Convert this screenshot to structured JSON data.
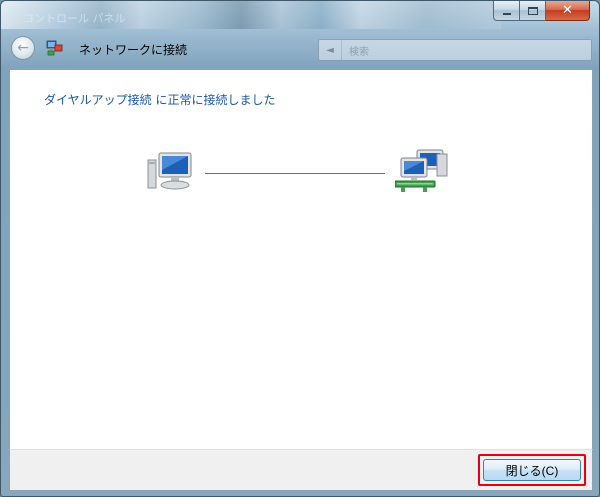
{
  "window": {
    "faint_title": "コントロール パネル",
    "controls": {
      "minimize_icon": "minimize-icon",
      "maximize_icon": "maximize-icon",
      "close_icon": "close-icon",
      "close_glyph": "✕"
    }
  },
  "navbar": {
    "back_icon": "back-arrow-icon",
    "back_glyph": "←",
    "title_icon": "network-connection-icon",
    "title": "ネットワークに接続",
    "search_icon": "search-icon",
    "search_placeholder": "検索"
  },
  "content": {
    "message": "ダイヤルアップ接続 に正常に接続しました",
    "left_icon": "computer-icon",
    "right_icon": "network-connected-icon"
  },
  "footer": {
    "close_label": "閉じる(C)"
  },
  "colors": {
    "message": "#1a57a2",
    "highlight_border": "#e60012",
    "close_caption": "#c43c1e"
  }
}
